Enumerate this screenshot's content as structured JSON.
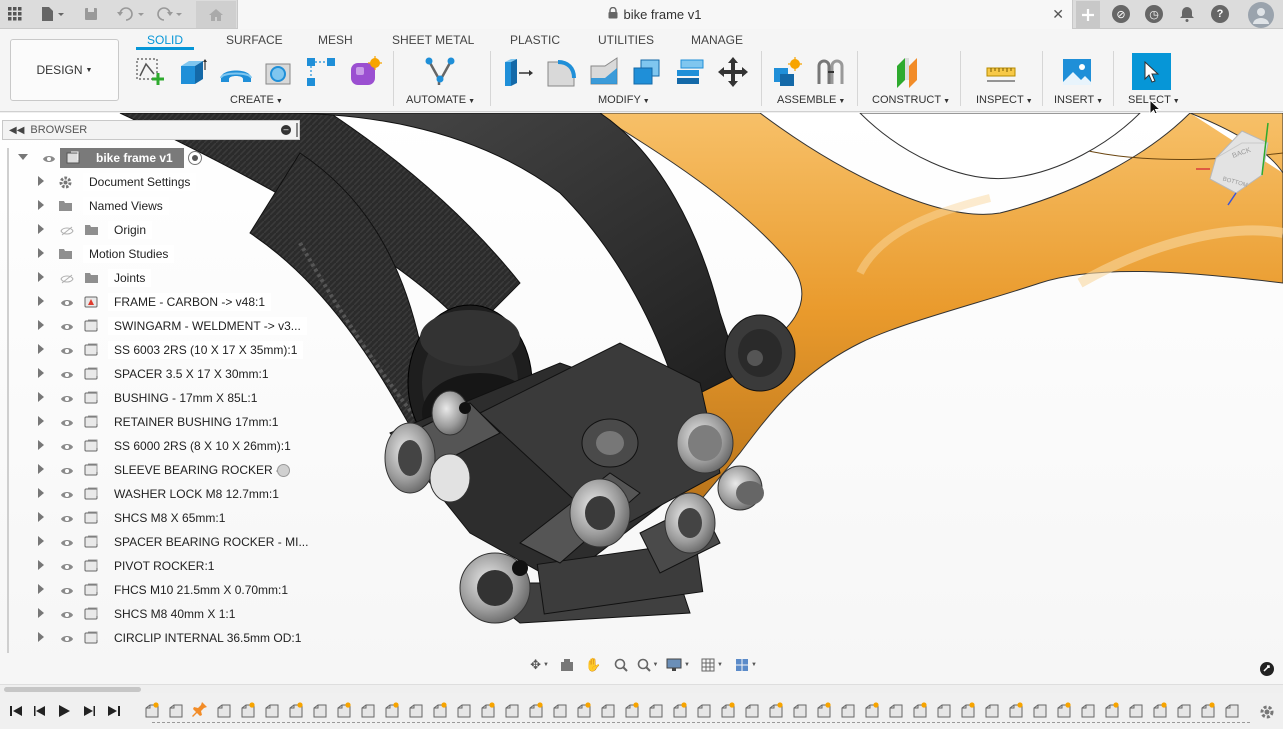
{
  "app": {
    "document_title": "bike frame v1"
  },
  "ribbon": {
    "workspace_button": "DESIGN",
    "tabs": [
      "SOLID",
      "SURFACE",
      "MESH",
      "SHEET METAL",
      "PLASTIC",
      "UTILITIES",
      "MANAGE"
    ],
    "active_tab": "SOLID",
    "groups": {
      "create": "CREATE",
      "automate": "AUTOMATE",
      "modify": "MODIFY",
      "assemble": "ASSEMBLE",
      "construct": "CONSTRUCT",
      "inspect": "INSPECT",
      "insert": "INSERT",
      "select": "SELECT"
    },
    "accent_color": "#0696d7"
  },
  "browser": {
    "title": "BROWSER",
    "root": "bike frame v1",
    "items": [
      {
        "label": "Document Settings",
        "icon": "gear-icon"
      },
      {
        "label": "Named Views",
        "icon": "folder-icon"
      },
      {
        "label": "Origin",
        "icon": "folder-icon",
        "hidden": true
      },
      {
        "label": "Motion Studies",
        "icon": "folder-icon"
      },
      {
        "label": "Joints",
        "icon": "folder-icon",
        "hidden": true
      },
      {
        "label": "FRAME - CARBON -> v48:1",
        "icon": "linked-component-icon"
      },
      {
        "label": "SWINGARM - WELDMENT -> v3...",
        "icon": "component-icon"
      },
      {
        "label": "SS 6003 2RS (10 X 17 X 35mm):1",
        "icon": "component-icon"
      },
      {
        "label": "SPACER 3.5 X 17 X 30mm:1",
        "icon": "component-icon"
      },
      {
        "label": "BUSHING - 17mm X 85L:1",
        "icon": "component-icon"
      },
      {
        "label": "RETAINER BUSHING 17mm:1",
        "icon": "component-icon"
      },
      {
        "label": "SS 6000 2RS (8 X 10 X 26mm):1",
        "icon": "component-icon"
      },
      {
        "label": "SLEEVE BEARING ROCKER -...",
        "icon": "component-icon"
      },
      {
        "label": "WASHER LOCK M8 12.7mm:1",
        "icon": "component-icon"
      },
      {
        "label": "SHCS M8 X 65mm:1",
        "icon": "component-icon"
      },
      {
        "label": "SPACER BEARING ROCKER - MI...",
        "icon": "component-icon"
      },
      {
        "label": "PIVOT ROCKER:1",
        "icon": "component-icon"
      },
      {
        "label": "FHCS M10 21.5mm X 0.70mm:1",
        "icon": "component-icon"
      },
      {
        "label": "SHCS M8 40mm X 1:1",
        "icon": "component-icon"
      },
      {
        "label": "CIRCLIP INTERNAL 36.5mm OD:1",
        "icon": "component-icon"
      }
    ]
  },
  "viewcube": {
    "faces": [
      "BACK",
      "BOTTOM"
    ]
  }
}
